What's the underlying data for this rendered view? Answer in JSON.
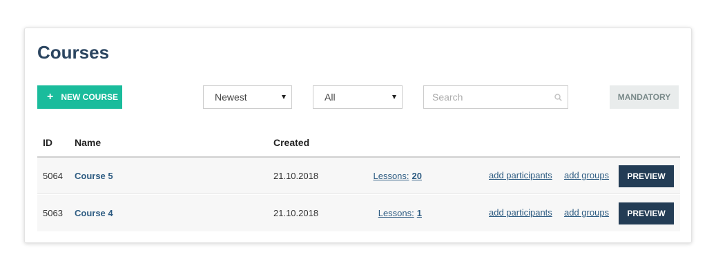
{
  "page": {
    "title": "Courses"
  },
  "toolbar": {
    "new_course_label": "New Course",
    "sort_select": {
      "value": "Newest"
    },
    "filter_select": {
      "value": "All"
    },
    "search": {
      "placeholder": "Search",
      "value": ""
    },
    "mandatory_label": "Mandatory"
  },
  "table": {
    "headers": {
      "id": "ID",
      "name": "Name",
      "created": "Created"
    },
    "rows": [
      {
        "id": "5064",
        "name": "Course 5",
        "created": "21.10.2018",
        "lessons_label": "Lessons:",
        "lessons_count": "20",
        "add_participants": "add participants",
        "add_groups": "add groups",
        "preview_label": "Preview"
      },
      {
        "id": "5063",
        "name": "Course 4",
        "created": "21.10.2018",
        "lessons_label": "Lessons:",
        "lessons_count": "1",
        "add_participants": "add participants",
        "add_groups": "add groups",
        "preview_label": "Preview"
      }
    ]
  },
  "colors": {
    "title": "#2b4560",
    "primary_button": "#1abc9c",
    "preview_button": "#233c55",
    "link": "#2e5c82",
    "mandatory_button_bg": "#e9ecec"
  },
  "icons": {
    "new_course": "plus-icon",
    "select_caret": "caret-down-icon",
    "search": "search-icon"
  }
}
